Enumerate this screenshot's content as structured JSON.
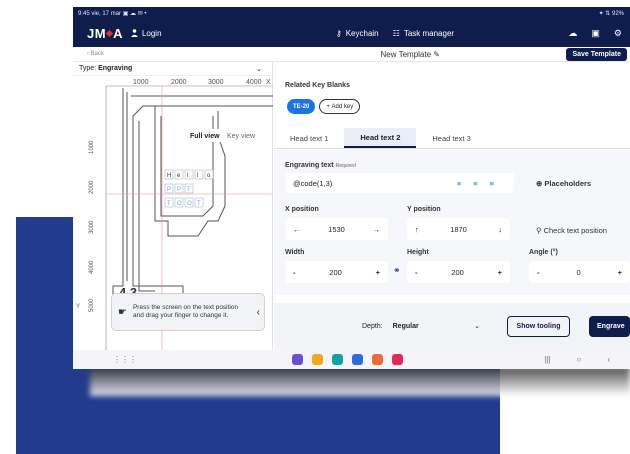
{
  "status": {
    "left": "9:45 vie, 17 mar ▣ ☁ ✉ •",
    "right": "✦ ⇅ 92%"
  },
  "nav": {
    "logo": "JMA",
    "login": "Login",
    "keychain": "Keychain",
    "task_manager": "Task manager"
  },
  "subbar": {
    "back": "Back",
    "template_name": "New Template",
    "save": "Save Template"
  },
  "left": {
    "type_label": "Type:",
    "type_value": "Engraving",
    "xticks": [
      "1000",
      "2000",
      "3000",
      "4000",
      "X"
    ],
    "yticks": [
      "1000",
      "2000",
      "3000",
      "4000",
      "5000"
    ],
    "y_axis": "Y",
    "views": [
      "Full view",
      "Key view"
    ],
    "key_rows": [
      [
        "H",
        "e",
        "l",
        "l",
        "o"
      ],
      [
        "P",
        "P",
        "T"
      ],
      [
        "T",
        "O",
        "O",
        "T"
      ]
    ],
    "key_numbers": "4 3",
    "hint": "Press the screen on the text position and drag your finger to change it."
  },
  "right": {
    "related_title": "Related Key Blanks",
    "chip": "TE-20",
    "add_key": "Add key",
    "tabs": [
      "Head text 1",
      "Head text 2",
      "Head text 3"
    ],
    "engraving_label": "Engraving text",
    "required": "Required",
    "engraving_value": "@code(1,3)",
    "placeholders": "Placeholders",
    "xpos_label": "X position",
    "xpos_value": "1530",
    "ypos_label": "Y position",
    "ypos_value": "1870",
    "check_text": "Check text position",
    "width_label": "Width",
    "width_value": "200",
    "height_label": "Height",
    "height_value": "200",
    "angle_label": "Angle (°)",
    "angle_value": "0",
    "depth_label": "Depth:",
    "depth_value": "Regular",
    "show_tooling": "Show tooling",
    "engrave": "Engrave"
  },
  "colors": {
    "navy": "#0f1d4d",
    "accent": "#1a73e8",
    "block": "#233b8c"
  },
  "dock": [
    {
      "name": "internet-app",
      "color": "#6b4fd8"
    },
    {
      "name": "files-app",
      "color": "#f5a623"
    },
    {
      "name": "calendar-app",
      "color": "#12a3a3"
    },
    {
      "name": "messages-app",
      "color": "#2d6cdf"
    },
    {
      "name": "contacts-app",
      "color": "#f06b3a"
    },
    {
      "name": "screen-recorder-app",
      "color": "#e5285a"
    }
  ]
}
